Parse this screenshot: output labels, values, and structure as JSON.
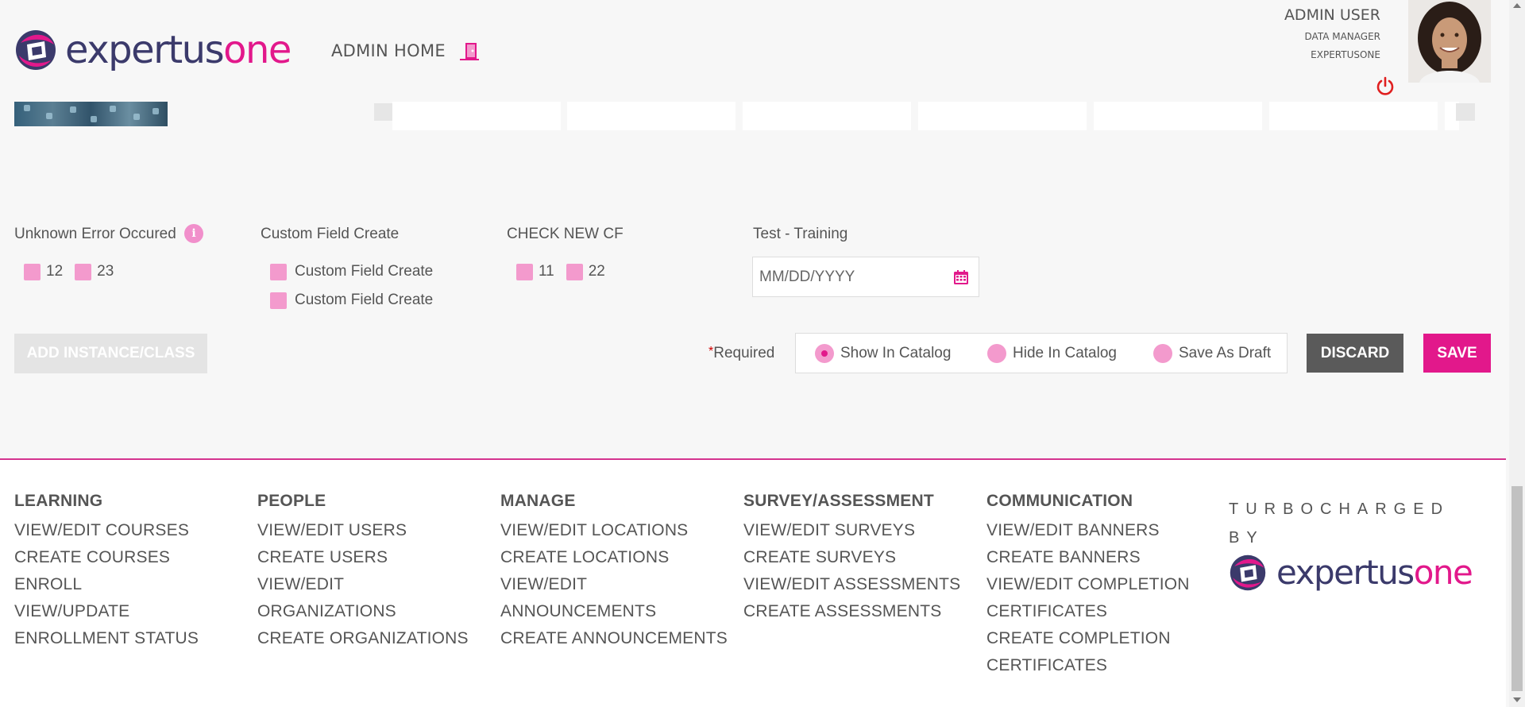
{
  "header": {
    "logo": {
      "part1": "expertus",
      "part2": "one"
    },
    "admin_home": "ADMIN HOME",
    "user": {
      "name": "ADMIN USER",
      "role": "DATA MANAGER",
      "org": "EXPERTUSONE"
    }
  },
  "form": {
    "fields": [
      {
        "label": "Unknown Error Occured",
        "has_info": true,
        "options": [
          "12",
          "23"
        ]
      },
      {
        "label": "Custom Field Create",
        "options": [
          "Custom Field Create",
          "Custom Field Create"
        ]
      },
      {
        "label": "CHECK NEW CF",
        "options": [
          "11",
          "22"
        ]
      },
      {
        "label": "Test - Training",
        "type": "date"
      }
    ],
    "date_placeholder": "MM/DD/YYYY",
    "add_instance_label": "ADD INSTANCE/CLASS",
    "required_star": "*",
    "required_label": "Required",
    "visibility": {
      "options": [
        "Show In Catalog",
        "Hide In Catalog",
        "Save As Draft"
      ],
      "selected": "Show In Catalog"
    },
    "discard_label": "DISCARD",
    "save_label": "SAVE"
  },
  "footer": {
    "columns": [
      {
        "title": "LEARNING",
        "links": [
          "VIEW/EDIT COURSES",
          "CREATE COURSES",
          "ENROLL",
          "VIEW/UPDATE",
          "ENROLLMENT STATUS"
        ]
      },
      {
        "title": "PEOPLE",
        "links": [
          "VIEW/EDIT USERS",
          "CREATE USERS",
          "VIEW/EDIT",
          "ORGANIZATIONS",
          "CREATE ORGANIZATIONS"
        ]
      },
      {
        "title": "MANAGE",
        "links": [
          "VIEW/EDIT LOCATIONS",
          "CREATE LOCATIONS",
          "VIEW/EDIT",
          "ANNOUNCEMENTS",
          "CREATE ANNOUNCEMENTS"
        ]
      },
      {
        "title": "SURVEY/ASSESSMENT",
        "links": [
          "VIEW/EDIT SURVEYS",
          "CREATE SURVEYS",
          "VIEW/EDIT ASSESSMENTS",
          "CREATE ASSESSMENTS"
        ]
      },
      {
        "title": "COMMUNICATION",
        "links": [
          "VIEW/EDIT BANNERS",
          "CREATE BANNERS",
          "VIEW/EDIT COMPLETION",
          "CERTIFICATES",
          "CREATE COMPLETION",
          "CERTIFICATES"
        ]
      }
    ],
    "turbo_line1": "TURBOCHARGED",
    "turbo_line2": "BY"
  },
  "colors": {
    "brand_pink": "#e2188b",
    "brand_navy": "#3b3a6b",
    "checkbox_pink": "#f39acd",
    "discard_gray": "#5a5a5a"
  },
  "icons": [
    "exit-door-icon",
    "power-icon",
    "info-icon",
    "calendar-icon"
  ]
}
